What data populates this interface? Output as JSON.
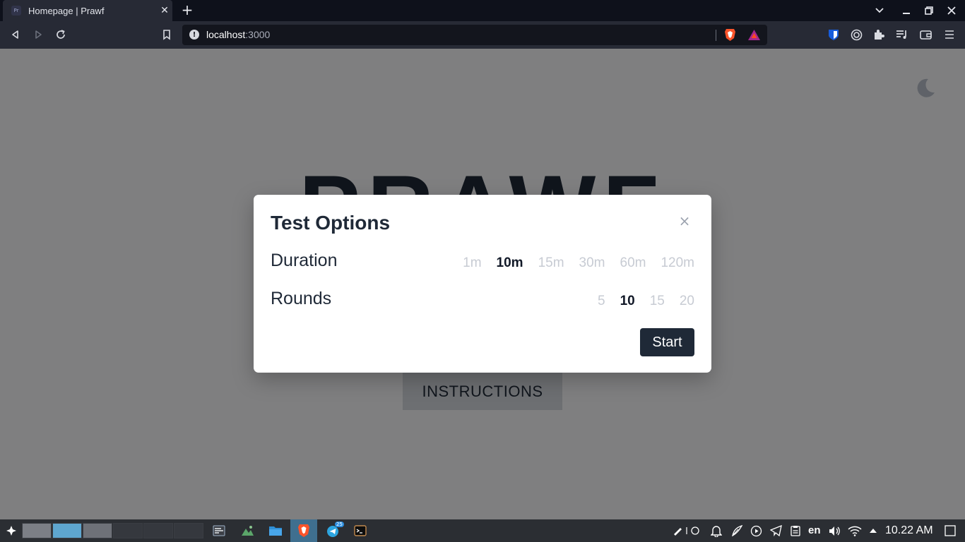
{
  "browser": {
    "tab_title": "Homepage | Prawf",
    "favicon_text": "Pr",
    "tab_close": "✕",
    "new_tab": "+",
    "url_host": "localhost",
    "url_port": ":3000"
  },
  "page": {
    "logo": "PRAWF",
    "instructions_label": "INSTRUCTIONS"
  },
  "modal": {
    "title": "Test Options",
    "close": "×",
    "duration": {
      "label": "Duration",
      "options": [
        "1m",
        "10m",
        "15m",
        "30m",
        "60m",
        "120m"
      ],
      "selected": "10m"
    },
    "rounds": {
      "label": "Rounds",
      "options": [
        "5",
        "10",
        "15",
        "20"
      ],
      "selected": "10"
    },
    "start_label": "Start"
  },
  "taskbar": {
    "telegram_badge": "25",
    "language": "en",
    "clock": "10.22 AM"
  },
  "colors": {
    "accent_dark": "#1f2937",
    "muted_option": "#c7cbd3",
    "workspace_active": "#5ea6cf"
  }
}
